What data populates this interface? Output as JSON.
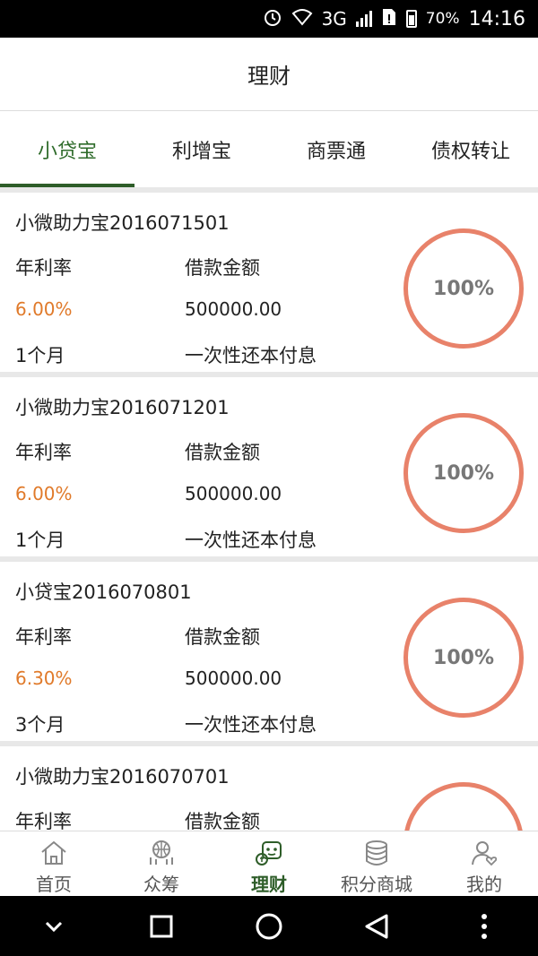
{
  "status_bar": {
    "network": "3G",
    "battery": "70%",
    "time": "14:16",
    "icons": [
      "alarm-icon",
      "wifi-icon",
      "signal-icon",
      "sim-alert-icon",
      "battery-icon"
    ]
  },
  "header": {
    "title": "理财"
  },
  "tabs": [
    {
      "label": "小贷宝",
      "active": true
    },
    {
      "label": "利增宝",
      "active": false
    },
    {
      "label": "商票通",
      "active": false
    },
    {
      "label": "债权转让",
      "active": false
    }
  ],
  "products": [
    {
      "name": "小微助力宝2016071501",
      "rate_label": "年利率",
      "amount_label": "借款金额",
      "rate": "6.00%",
      "amount": "500000.00",
      "term": "1个月",
      "repayment": "一次性还本付息",
      "progress": "100%"
    },
    {
      "name": "小微助力宝2016071201",
      "rate_label": "年利率",
      "amount_label": "借款金额",
      "rate": "6.00%",
      "amount": "500000.00",
      "term": "1个月",
      "repayment": "一次性还本付息",
      "progress": "100%"
    },
    {
      "name": "小贷宝2016070801",
      "rate_label": "年利率",
      "amount_label": "借款金额",
      "rate": "6.30%",
      "amount": "500000.00",
      "term": "3个月",
      "repayment": "一次性还本付息",
      "progress": "100%"
    },
    {
      "name": "小微助力宝2016070701",
      "rate_label": "年利率",
      "amount_label": "借款金额",
      "rate": "",
      "amount": "",
      "term": "",
      "repayment": "",
      "progress": ""
    }
  ],
  "bottom_nav": [
    {
      "label": "首页",
      "icon": "home-icon",
      "active": false
    },
    {
      "label": "众筹",
      "icon": "crowdfunding-icon",
      "active": false
    },
    {
      "label": "理财",
      "icon": "finance-icon",
      "active": true
    },
    {
      "label": "积分商城",
      "icon": "coins-icon",
      "active": false
    },
    {
      "label": "我的",
      "icon": "profile-icon",
      "active": false
    }
  ],
  "colors": {
    "accent_green": "#2e5d29",
    "rate_orange": "#e07a2a",
    "ring_coral": "#e8826a",
    "separator_gray": "#e8e8e8"
  }
}
